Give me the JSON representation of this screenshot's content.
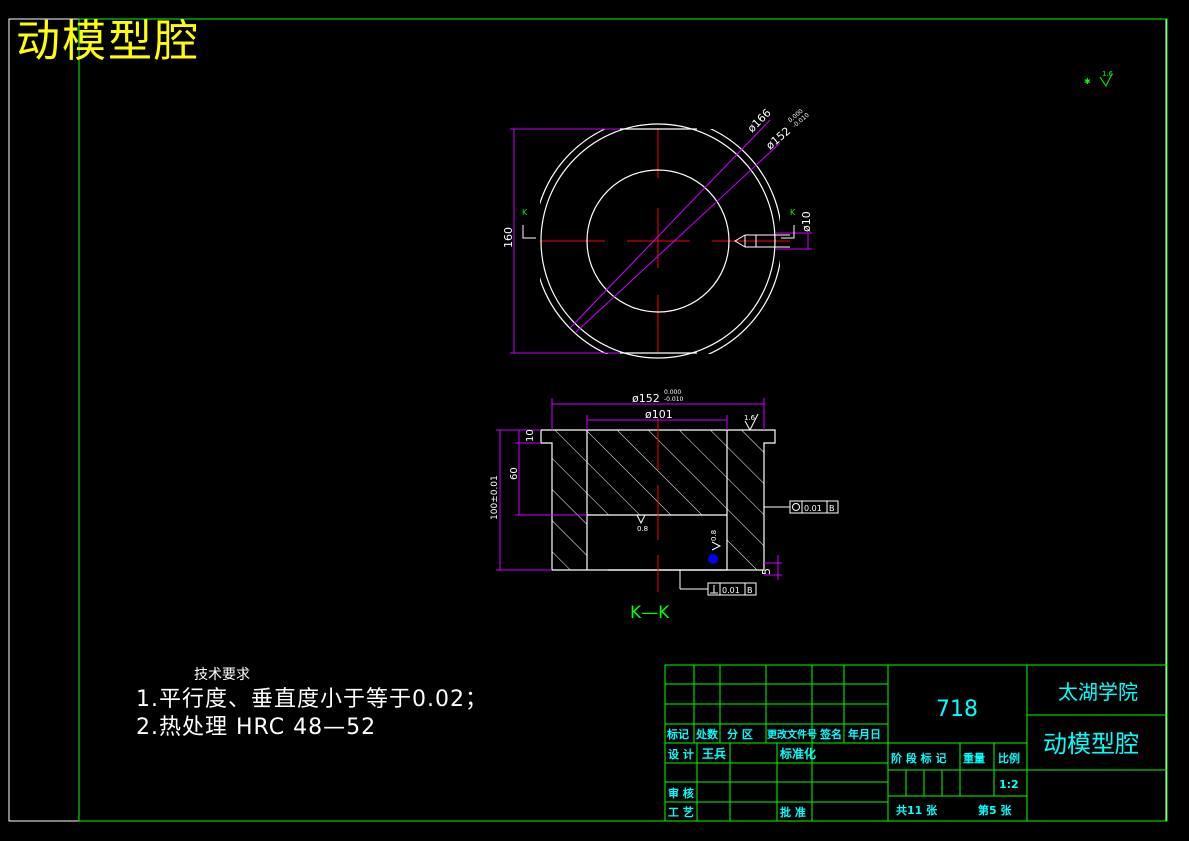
{
  "title": "动模型腔",
  "colors": {
    "frame": "#00ff00",
    "outline": "#ffffff",
    "dimension": "#cc00ff",
    "centerline": "#ff0000",
    "title_text": "#ffff00",
    "table_text": "#00ffff"
  },
  "top_view": {
    "dim_outer_diameter": "ø166",
    "dim_bore": "ø152",
    "dim_bore_tol_upper": "0.000",
    "dim_bore_tol_lower": "-0.010",
    "dim_height_160": "160",
    "dim_hole": "ø10",
    "section_marker_left": "K",
    "section_marker_right": "K"
  },
  "section_view": {
    "dim_outer": "ø152",
    "dim_outer_tol_upper": "0.000",
    "dim_outer_tol_lower": "-0.010",
    "dim_inner": "ø101",
    "dim_10": "10",
    "dim_60": "60",
    "dim_100": "100±0.01",
    "dim_5": "5",
    "roughness_top": "1.6",
    "roughness_inner": "0.8",
    "roughness_side": "0.8",
    "tolerance_flatness_value": "0.01",
    "tolerance_flatness_ref": "B",
    "tolerance_perp_value": "0.01",
    "tolerance_perp_ref": "B",
    "label": "K—K"
  },
  "corner_roughness": "1.6",
  "tech_requirements": {
    "heading": "技术要求",
    "line1": "1.平行度、垂直度小于等于0.02；",
    "line2": "2.热处理  HRC  48—52"
  },
  "title_block": {
    "drawing_number": "718",
    "school": "太湖学院",
    "part_name": "动模型腔",
    "header_cells": [
      "标记",
      "处数",
      "分 区",
      "更改文件号",
      "签名",
      "年月日"
    ],
    "design_label": "设 计",
    "designer": "王兵",
    "standardize_label": "标准化",
    "review_label": "审 核",
    "process_label": "工 艺",
    "approve_label": "批 准",
    "stage_label": "阶 段 标 记",
    "weight_label": "重量",
    "scale_label": "比例",
    "scale_value": "1:2",
    "total_sheets": "共11 张",
    "sheet_no": "第5 张"
  }
}
